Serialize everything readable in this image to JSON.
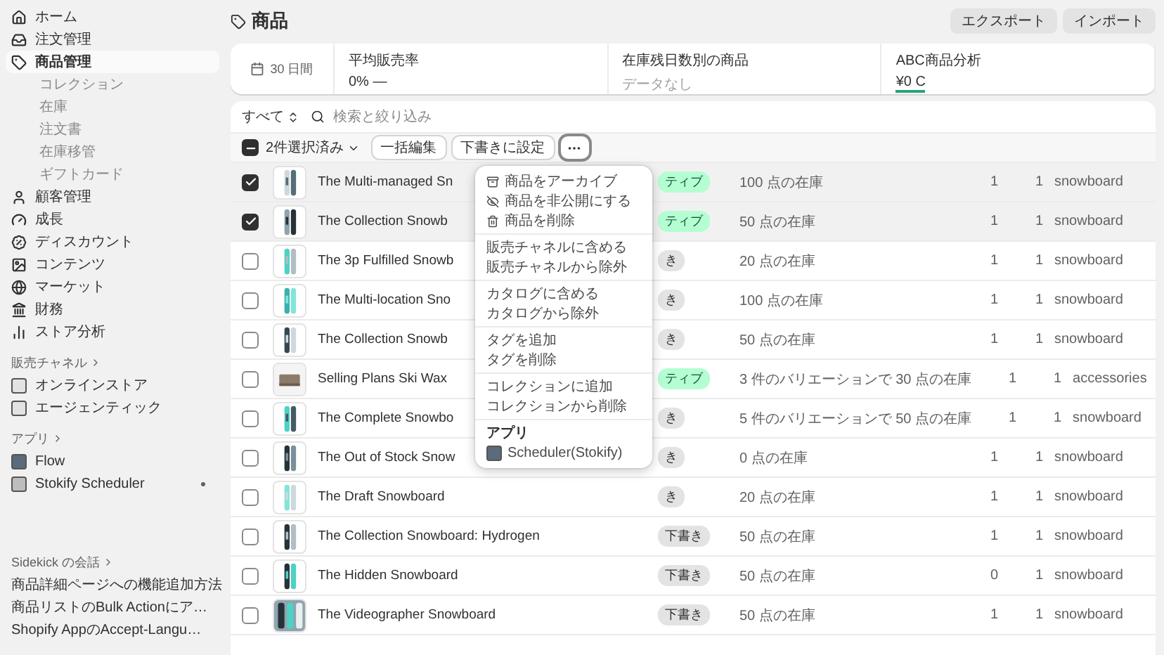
{
  "sidebar": {
    "items": [
      {
        "label": "ホーム",
        "selected": false
      },
      {
        "label": "注文管理",
        "selected": false
      },
      {
        "label": "商品管理",
        "selected": true,
        "children": [
          {
            "label": "コレクション"
          },
          {
            "label": "在庫"
          },
          {
            "label": "注文書"
          },
          {
            "label": "在庫移管"
          },
          {
            "label": "ギフトカード"
          }
        ]
      },
      {
        "label": "顧客管理",
        "selected": false
      },
      {
        "label": "成長",
        "selected": false
      },
      {
        "label": "ディスカウント",
        "selected": false
      },
      {
        "label": "コンテンツ",
        "selected": false
      },
      {
        "label": "マーケット",
        "selected": false
      },
      {
        "label": "財務",
        "selected": false
      },
      {
        "label": "ストア分析",
        "selected": false
      }
    ],
    "sales_channels": {
      "title": "販売チャネル",
      "items": [
        {
          "label": "オンラインストア"
        },
        {
          "label": "エージェンティック"
        }
      ]
    },
    "apps": {
      "title": "アプリ",
      "items": [
        {
          "label": "Flow",
          "pinned": false
        },
        {
          "label": "Stokify Scheduler",
          "pinned": true
        }
      ]
    },
    "sidekick": {
      "title": "Sidekick の会話",
      "items": [
        {
          "label": "商品詳細ページへの機能追加方法"
        },
        {
          "label": "商品リストのBulk Actionにア…"
        },
        {
          "label": "Shopify AppのAccept-Langu…"
        }
      ]
    }
  },
  "page": {
    "title": "商品",
    "buttons": [
      "エクスポート",
      "インポート"
    ]
  },
  "stats": {
    "period": "30 日間",
    "metrics": [
      {
        "label": "平均販売率",
        "value": "0% —",
        "empty": false,
        "underline": false
      },
      {
        "label": "在庫残日数別の商品",
        "value": "データなし",
        "empty": true,
        "underline": false
      },
      {
        "label": "ABC商品分析",
        "value": "¥0 C",
        "empty": false,
        "underline": true
      }
    ]
  },
  "filter": {
    "view": "すべて",
    "search": {
      "placeholder": "検索と絞り込み"
    }
  },
  "bulk": {
    "indeterminate": true,
    "label": "2件選択済み",
    "actions": [
      "一括編集",
      "下書きに設定"
    ],
    "more_expanded": true
  },
  "menu": {
    "groups": [
      {
        "items": [
          "商品をアーカイブ",
          "商品を非公開にする",
          "商品を削除"
        ]
      },
      {
        "items": [
          "販売チャネルに含める",
          "販売チャネルから除外"
        ]
      },
      {
        "items": [
          "カタログに含める",
          "カタログから除外"
        ]
      },
      {
        "items": [
          "タグを追加",
          "タグを削除"
        ]
      },
      {
        "items": [
          "コレクションに追加",
          "コレクションから削除"
        ]
      }
    ],
    "apps": {
      "title": "アプリ",
      "items": [
        "Scheduler(Stokify)"
      ]
    }
  },
  "rows": [
    {
      "selected": true,
      "name": "The Multi-managed Sn",
      "status": {
        "kind": "active",
        "text": "ティブ"
      },
      "inventory": "100 点の在庫",
      "column_6": "1",
      "column_7": "1",
      "column_8": "snowboard"
    },
    {
      "selected": true,
      "name": "The Collection Snowb",
      "status": {
        "kind": "active",
        "text": "ティブ"
      },
      "inventory": "50 点の在庫",
      "column_6": "1",
      "column_7": "1",
      "column_8": "snowboard"
    },
    {
      "selected": false,
      "name": "The 3p Fulfilled Snowb",
      "status": {
        "kind": "draft",
        "text": "き"
      },
      "inventory": "20 点の在庫",
      "column_6": "1",
      "column_7": "1",
      "column_8": "snowboard"
    },
    {
      "selected": false,
      "name": "The Multi-location Sno",
      "status": {
        "kind": "draft",
        "text": "き"
      },
      "inventory": "100 点の在庫",
      "column_6": "1",
      "column_7": "1",
      "column_8": "snowboard"
    },
    {
      "selected": false,
      "name": "The Collection Snowb",
      "status": {
        "kind": "draft",
        "text": "き"
      },
      "inventory": "50 点の在庫",
      "column_6": "1",
      "column_7": "1",
      "column_8": "snowboard"
    },
    {
      "selected": false,
      "name": "Selling Plans Ski Wax",
      "status": {
        "kind": "active",
        "text": "ティブ"
      },
      "inventory": "3 件のバリエーションで 30 点の在庫",
      "column_6": "1",
      "column_7": "1",
      "column_8": "accessories"
    },
    {
      "selected": false,
      "name": "The Complete Snowbo",
      "status": {
        "kind": "draft",
        "text": "き"
      },
      "inventory": "5 件のバリエーションで 50 点の在庫",
      "column_6": "1",
      "column_7": "1",
      "column_8": "snowboard"
    },
    {
      "selected": false,
      "name": "The Out of Stock Snow",
      "status": {
        "kind": "draft",
        "text": "き"
      },
      "inventory": "0 点の在庫",
      "column_6": "1",
      "column_7": "1",
      "column_8": "snowboard"
    },
    {
      "selected": false,
      "name": "The Draft Snowboard",
      "status": {
        "kind": "draft",
        "text": "き"
      },
      "inventory": "20 点の在庫",
      "column_6": "1",
      "column_7": "1",
      "column_8": "snowboard"
    },
    {
      "selected": false,
      "name": "The Collection Snowboard: Hydrogen",
      "status": {
        "kind": "draft",
        "text": "下書き"
      },
      "inventory": "50 点の在庫",
      "column_6": "1",
      "column_7": "1",
      "column_8": "snowboard"
    },
    {
      "selected": false,
      "name": "The Hidden Snowboard",
      "status": {
        "kind": "draft",
        "text": "下書き"
      },
      "inventory": "50 点の在庫",
      "column_6": "0",
      "column_7": "1",
      "column_8": "snowboard"
    },
    {
      "selected": false,
      "name": "The Videographer Snowboard",
      "status": {
        "kind": "draft",
        "text": "下書き"
      },
      "inventory": "50 点の在庫",
      "column_6": "1",
      "column_7": "1",
      "column_8": "snowboard"
    }
  ]
}
